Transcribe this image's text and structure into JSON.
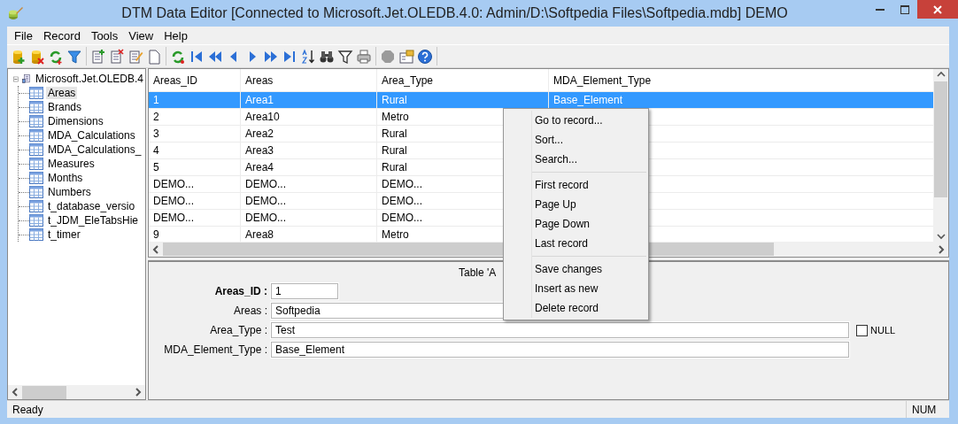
{
  "window": {
    "title": "DTM Data Editor [Connected to Microsoft.Jet.OLEDB.4.0: Admin/D:\\Softpedia Files\\Softpedia.mdb] DEMO"
  },
  "menu": [
    "File",
    "Record",
    "Tools",
    "View",
    "Help"
  ],
  "tree": {
    "root": {
      "label": "Microsoft.Jet.OLEDB.4",
      "expanded": true,
      "children": [
        {
          "label": "Areas",
          "selected": true
        },
        {
          "label": "Brands",
          "selected": false
        },
        {
          "label": "Dimensions",
          "selected": false
        },
        {
          "label": "MDA_Calculations",
          "selected": false
        },
        {
          "label": "MDA_Calculations_",
          "selected": false
        },
        {
          "label": "Measures",
          "selected": false
        },
        {
          "label": "Months",
          "selected": false
        },
        {
          "label": "Numbers",
          "selected": false
        },
        {
          "label": "t_database_versio",
          "selected": false
        },
        {
          "label": "t_JDM_EleTabsHie",
          "selected": false
        },
        {
          "label": "t_timer",
          "selected": false
        }
      ]
    }
  },
  "grid": {
    "columns": [
      "Areas_ID",
      "Areas",
      "Area_Type",
      "MDA_Element_Type"
    ],
    "rows": [
      {
        "cells": [
          "1",
          "Area1",
          "Rural",
          "Base_Element"
        ],
        "selected": true
      },
      {
        "cells": [
          "2",
          "Area10",
          "Metro"
        ],
        "selected": false
      },
      {
        "cells": [
          "3",
          "Area2",
          "Rural"
        ],
        "selected": false
      },
      {
        "cells": [
          "4",
          "Area3",
          "Rural"
        ],
        "selected": false
      },
      {
        "cells": [
          "5",
          "Area4",
          "Rural"
        ],
        "selected": false
      },
      {
        "cells": [
          "DEMO...",
          "DEMO...",
          "DEMO..."
        ],
        "selected": false
      },
      {
        "cells": [
          "DEMO...",
          "DEMO...",
          "DEMO..."
        ],
        "selected": false
      },
      {
        "cells": [
          "DEMO...",
          "DEMO...",
          "DEMO..."
        ],
        "selected": false
      },
      {
        "cells": [
          "9",
          "Area8",
          "Metro"
        ],
        "selected": false
      }
    ]
  },
  "context_menu": {
    "groups": [
      [
        "Go to record...",
        "Sort...",
        "Search..."
      ],
      [
        "First record",
        "Page Up",
        "Page Down",
        "Last record"
      ],
      [
        "Save changes",
        "Insert as new",
        "Delete record"
      ]
    ]
  },
  "detail": {
    "caption": "Table 'A",
    "fields": [
      {
        "label": "Areas_ID :",
        "value": "1",
        "key": true,
        "kind": "short"
      },
      {
        "label": "Areas :",
        "value": "Softpedia",
        "key": false,
        "kind": "medium"
      },
      {
        "label": "Area_Type :",
        "value": "Test",
        "key": false,
        "kind": "long",
        "null_option": {
          "label": "NULL",
          "checked": false
        }
      },
      {
        "label": "MDA_Element_Type :",
        "value": "Base_Element",
        "key": false,
        "kind": "long"
      }
    ]
  },
  "status_bar": [
    "Ready",
    "NUM"
  ]
}
